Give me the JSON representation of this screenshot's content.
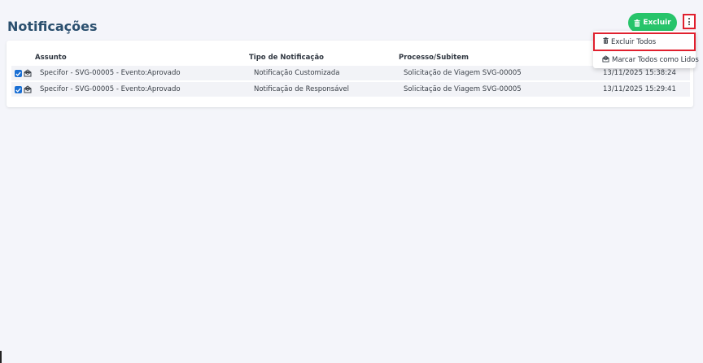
{
  "page": {
    "title": "Notificações"
  },
  "toolbar": {
    "excluir_label": "Excluir"
  },
  "menu": {
    "items": [
      {
        "label": "Excluir Todos",
        "icon": "trash-icon"
      },
      {
        "label": "Marcar Todos como Lidos",
        "icon": "envelope-open-icon"
      }
    ]
  },
  "table": {
    "columns": [
      "Assunto",
      "Tipo de Notificação",
      "Processo/Subitem"
    ],
    "rows": [
      {
        "checked": true,
        "assunto": "Specifor - SVG-00005 - Evento:Aprovado",
        "tipo": "Notificação Customizada",
        "processo": "Solicitação de Viagem SVG-00005",
        "data": "13/11/2025 15:38:24"
      },
      {
        "checked": true,
        "assunto": "Specifor - SVG-00005 - Evento:Aprovado",
        "tipo": "Notificação de Responsável",
        "processo": "Solicitação de Viagem SVG-00005",
        "data": "13/11/2025 15:29:41"
      }
    ]
  },
  "colors": {
    "accent_green": "#27c46a",
    "title_blue": "#2a4f6e",
    "checkbox_blue": "#1a6fd4",
    "highlight_red": "#e0202e"
  }
}
